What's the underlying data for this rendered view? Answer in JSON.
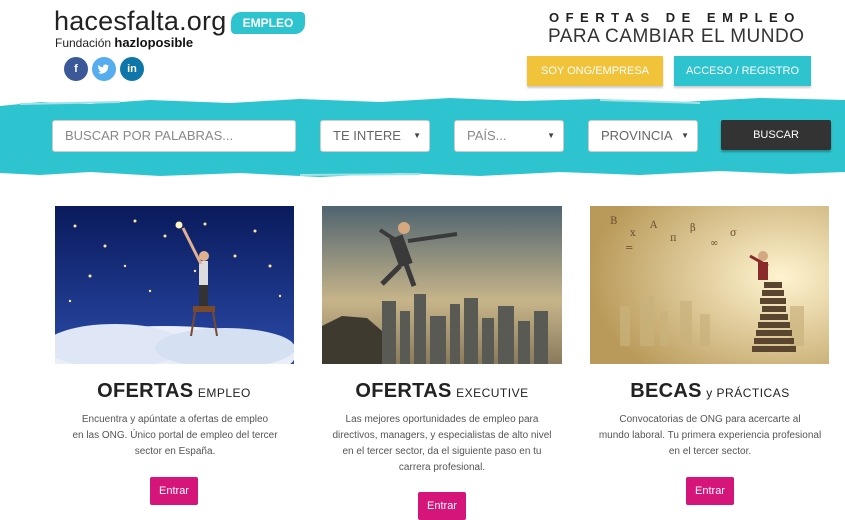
{
  "header": {
    "logo_text": "hacesfalta.org",
    "badge": "EMPLEO",
    "foundation_prefix": "Fundación",
    "foundation_name": "hazloposible",
    "social": [
      {
        "label": "f",
        "color": "#3b5998"
      },
      {
        "label": "t",
        "color": "#55acee"
      },
      {
        "label": "in",
        "color": "#0e76a8"
      }
    ],
    "tagline_1": "OFERTAS DE EMPLEO",
    "tagline_2": "PARA CAMBIAR EL MUNDO",
    "btn_ong": "SOY ONG/EMPRESA",
    "btn_acceso": "ACCESO / REGISTRO"
  },
  "search": {
    "keywords_placeholder": "BUSCAR POR PALABRAS...",
    "interest": "TE INTERE",
    "country": "PAÍS...",
    "province": "PROVINCIA",
    "submit": "BUSCAR"
  },
  "cards": [
    {
      "title_big": "OFERTAS",
      "title_small": "EMPLEO",
      "desc": [
        "Encuentra y apúntate a ofertas de empleo",
        "en las ONG. Único portal de empleo del tercer",
        "sector en España."
      ],
      "button": "Entrar"
    },
    {
      "title_big": "OFERTAS",
      "title_small": "EXECUTIVE",
      "desc": [
        "Las mejores oportunidades de empleo para",
        "directivos, managers, y especialistas de alto nivel",
        "en el tercer sector, da el siguiente paso en tu",
        "carrera profesional."
      ],
      "button": "Entrar"
    },
    {
      "title_big": "BECAS",
      "title_small": "y PRÁCTICAS",
      "desc": [
        "Convocatorias de ONG para acercarte al",
        "mundo laboral. Tu primera experiencia profesional",
        "en el tercer sector."
      ],
      "button": "Entrar"
    }
  ],
  "colors": {
    "teal": "#2ec4cf",
    "yellow": "#f0c33a",
    "magenta": "#d6157a",
    "dark": "#333333"
  }
}
